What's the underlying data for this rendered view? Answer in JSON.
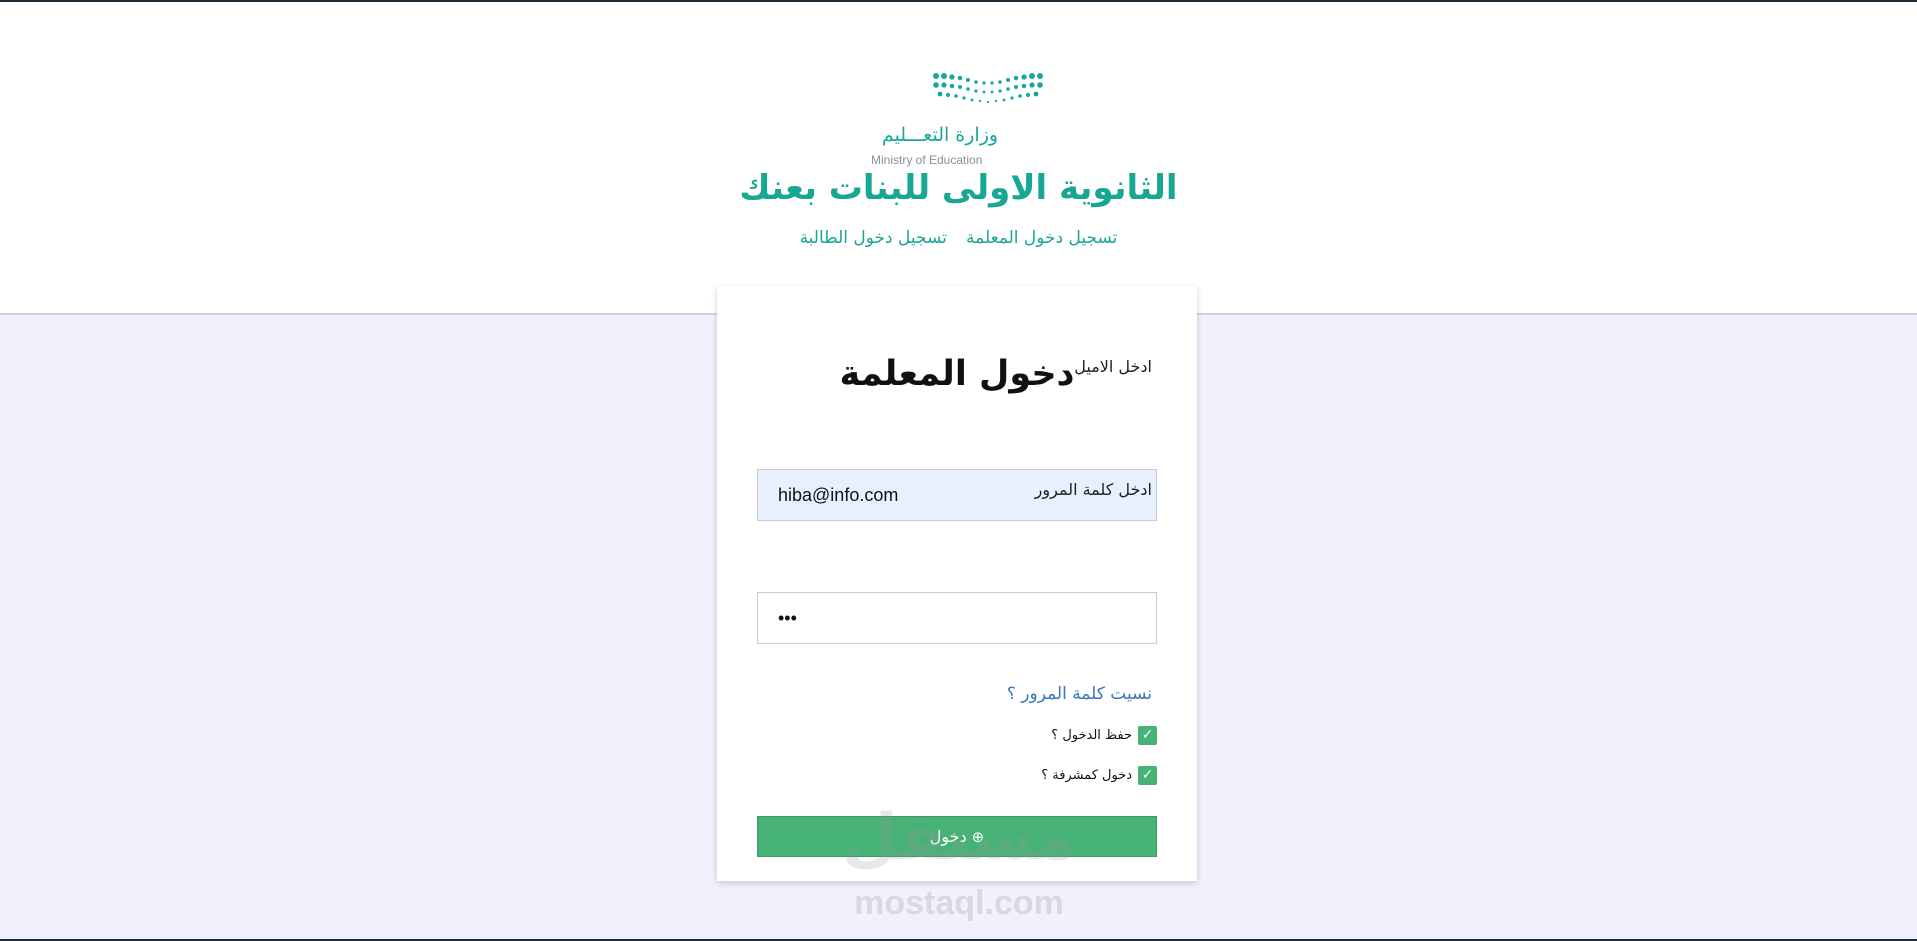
{
  "colors": {
    "brand_teal": "#17a793",
    "button_green": "#47b276",
    "page_background": "#f1f1fd",
    "email_autofill_background": "#e8f0fe"
  },
  "header": {
    "logo": {
      "arabic": "وزارة التعـــليم",
      "english": "Ministry of Education"
    },
    "school_name": "الثانوية الاولى للبنات بعنك",
    "nav_links": [
      {
        "label": "تسجيل دخول المعلمة"
      },
      {
        "label": "تسجيل دخول الطالبة"
      }
    ]
  },
  "login_form": {
    "title": "دخول المعلمة",
    "email": {
      "label": "ادخل الاميل",
      "value": "hiba@info.com"
    },
    "password": {
      "label": "ادخل كلمة المرور",
      "value": "•••"
    },
    "forgot_password_label": "نسيت كلمة المرور ؟",
    "remember_me": {
      "label": "حفظ الدخول ؟",
      "checked": true
    },
    "supervisor_login": {
      "label": "دخول كمشرفة ؟",
      "checked": true
    },
    "submit_label": "دخول",
    "submit_icon": "login-icon"
  },
  "watermark": {
    "arabic": "مستقل",
    "english": "mostaql.com"
  }
}
